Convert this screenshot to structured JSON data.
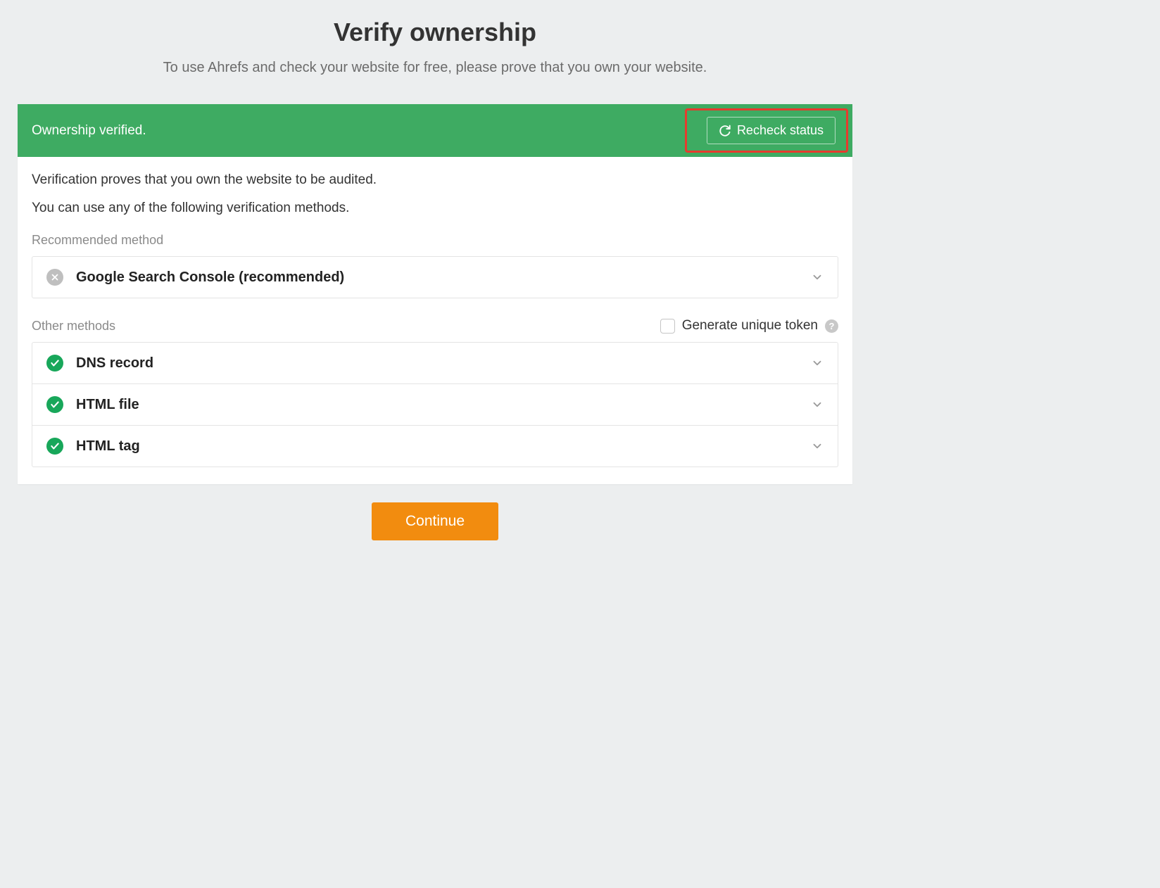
{
  "header": {
    "title": "Verify ownership",
    "subtitle": "To use Ahrefs and check your website for free, please prove that you own your website."
  },
  "status": {
    "message": "Ownership verified.",
    "recheck_label": "Recheck status"
  },
  "body": {
    "line1": "Verification proves that you own the website to be audited.",
    "line2": "You can use any of the following verification methods."
  },
  "sections": {
    "recommended_label": "Recommended method",
    "other_label": "Other methods",
    "generate_token_label": "Generate unique token"
  },
  "methods": {
    "recommended": {
      "title": "Google Search Console (recommended)",
      "verified": false
    },
    "others": [
      {
        "title": "DNS record",
        "verified": true
      },
      {
        "title": "HTML file",
        "verified": true
      },
      {
        "title": "HTML tag",
        "verified": true
      }
    ]
  },
  "footer": {
    "continue_label": "Continue"
  }
}
